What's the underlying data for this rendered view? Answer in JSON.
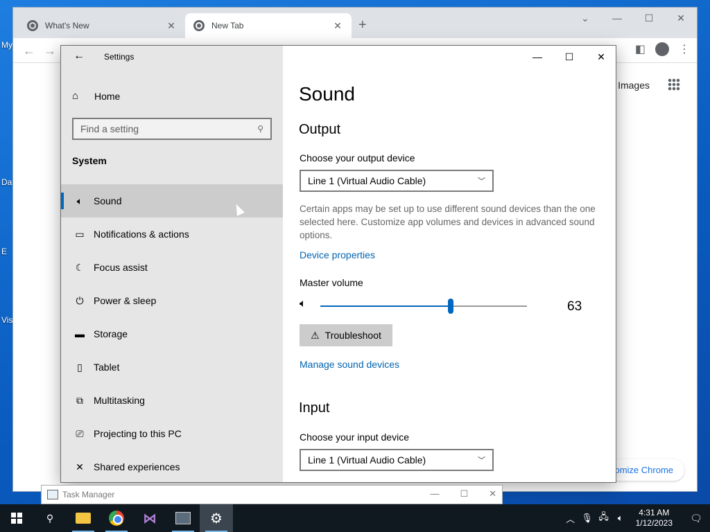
{
  "desktop": {
    "labels": [
      "My",
      "Da",
      "E",
      "Vis"
    ]
  },
  "chrome": {
    "tabs": [
      {
        "label": "What's New"
      },
      {
        "label": "New Tab"
      }
    ],
    "images_link": "Images",
    "customize_label": "ıtomize Chrome"
  },
  "settings": {
    "window_title": "Settings",
    "home_label": "Home",
    "search_placeholder": "Find a setting",
    "category": "System",
    "nav_items": [
      {
        "label": "Sound",
        "icon": "speaker-icon"
      },
      {
        "label": "Notifications & actions",
        "icon": "message-icon"
      },
      {
        "label": "Focus assist",
        "icon": "moon-icon"
      },
      {
        "label": "Power & sleep",
        "icon": "power-icon"
      },
      {
        "label": "Storage",
        "icon": "storage-icon"
      },
      {
        "label": "Tablet",
        "icon": "tablet-icon"
      },
      {
        "label": "Multitasking",
        "icon": "multitasking-icon"
      },
      {
        "label": "Projecting to this PC",
        "icon": "projector-icon"
      },
      {
        "label": "Shared experiences",
        "icon": "shared-icon"
      }
    ],
    "selected_index": 0,
    "page_title": "Sound",
    "output": {
      "heading": "Output",
      "device_label": "Choose your output device",
      "device_value": "Line 1 (Virtual Audio Cable)",
      "description": "Certain apps may be set up to use different sound devices than the one selected here. Customize app volumes and devices in advanced sound options.",
      "device_properties_link": "Device properties",
      "master_volume_label": "Master volume",
      "volume": 63,
      "troubleshoot_label": "Troubleshoot",
      "manage_link": "Manage sound devices"
    },
    "input": {
      "heading": "Input",
      "device_label": "Choose your input device",
      "device_value": "Line 1 (Virtual Audio Cable)"
    }
  },
  "task_manager": {
    "title": "Task Manager"
  },
  "taskbar": {
    "time": "4:31 AM",
    "date": "1/12/2023"
  },
  "colors": {
    "accent": "#0067c0",
    "link": "#0063b1",
    "nav_bg": "#e6e6e6",
    "selected_bg": "#cccccc"
  }
}
